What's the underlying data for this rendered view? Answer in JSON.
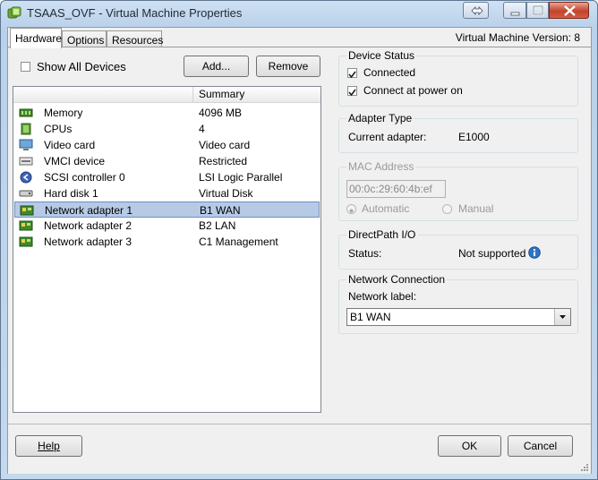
{
  "window": {
    "title": "TSAAS_OVF - Virtual Machine Properties",
    "app_icon": "vm-properties-icon",
    "controls": [
      "restore-icon",
      "minimize-icon",
      "maximize-icon",
      "close-icon"
    ]
  },
  "tabs": [
    {
      "label": "Hardware",
      "active": true
    },
    {
      "label": "Options",
      "active": false
    },
    {
      "label": "Resources",
      "active": false
    }
  ],
  "vm_version": "Virtual Machine Version: 8",
  "hardware": {
    "show_all_devices_label": "Show All Devices",
    "show_all_devices_checked": false,
    "add_button": "Add...",
    "remove_button": "Remove",
    "column_summary": "Summary",
    "devices": [
      {
        "name": "Memory",
        "summary": "4096 MB",
        "icon": "memory-icon"
      },
      {
        "name": "CPUs",
        "summary": "4",
        "icon": "cpu-icon"
      },
      {
        "name": "Video card",
        "summary": "Video card",
        "icon": "video-card-icon"
      },
      {
        "name": "VMCI device",
        "summary": "Restricted",
        "icon": "vmci-device-icon"
      },
      {
        "name": "SCSI controller 0",
        "summary": "LSI Logic Parallel",
        "icon": "scsi-controller-icon"
      },
      {
        "name": "Hard disk 1",
        "summary": "Virtual Disk",
        "icon": "hard-disk-icon"
      },
      {
        "name": "Network adapter 1",
        "summary": "B1 WAN",
        "icon": "network-adapter-icon",
        "selected": true
      },
      {
        "name": "Network adapter 2",
        "summary": "B2 LAN",
        "icon": "network-adapter-icon"
      },
      {
        "name": "Network adapter 3",
        "summary": "C1 Management",
        "icon": "network-adapter-icon"
      }
    ]
  },
  "device_status": {
    "legend": "Device Status",
    "connected_label": "Connected",
    "connected_checked": true,
    "connect_at_power_on_label": "Connect at power on",
    "connect_at_power_on_checked": true
  },
  "adapter_type": {
    "legend": "Adapter Type",
    "current_adapter_label": "Current adapter:",
    "current_adapter_value": "E1000"
  },
  "mac_address": {
    "legend": "MAC Address",
    "value": "00:0c:29:60:4b:ef",
    "automatic_label": "Automatic",
    "manual_label": "Manual",
    "selected": "automatic"
  },
  "directpath": {
    "legend": "DirectPath I/O",
    "status_label": "Status:",
    "status_value": "Not supported",
    "info_icon": "info-icon"
  },
  "network_connection": {
    "legend": "Network Connection",
    "network_label_label": "Network label:",
    "network_label_value": "B1 WAN"
  },
  "footer": {
    "help_button": "Help",
    "ok_button": "OK",
    "cancel_button": "Cancel"
  }
}
